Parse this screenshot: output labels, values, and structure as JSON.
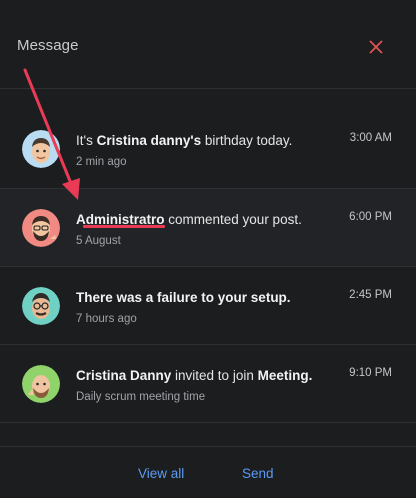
{
  "header": {
    "title": "Message"
  },
  "notifications": [
    {
      "pre": "It's ",
      "bold": "Cristina danny's",
      "post": " birthday today.",
      "sub": "2 min ago",
      "time": "3:00 AM"
    },
    {
      "pre": "",
      "bold": "Administratro",
      "post": " commented your post.",
      "sub": "5 August",
      "time": "6:00 PM"
    },
    {
      "pre": "",
      "bold": "There was a failure to your setup.",
      "post": "",
      "sub": "7 hours ago",
      "time": "2:45 PM"
    },
    {
      "pre": "",
      "bold": "Cristina Danny",
      "post": " invited to join ",
      "bold2": "Meeting.",
      "sub": "Daily scrum meeting time",
      "time": "9:10 PM"
    }
  ],
  "footer": {
    "view_all": "View all",
    "send": "Send"
  },
  "colors": {
    "accent_red": "#ea3b56",
    "link_blue": "#5b9bf5",
    "close_red": "#e05252"
  }
}
